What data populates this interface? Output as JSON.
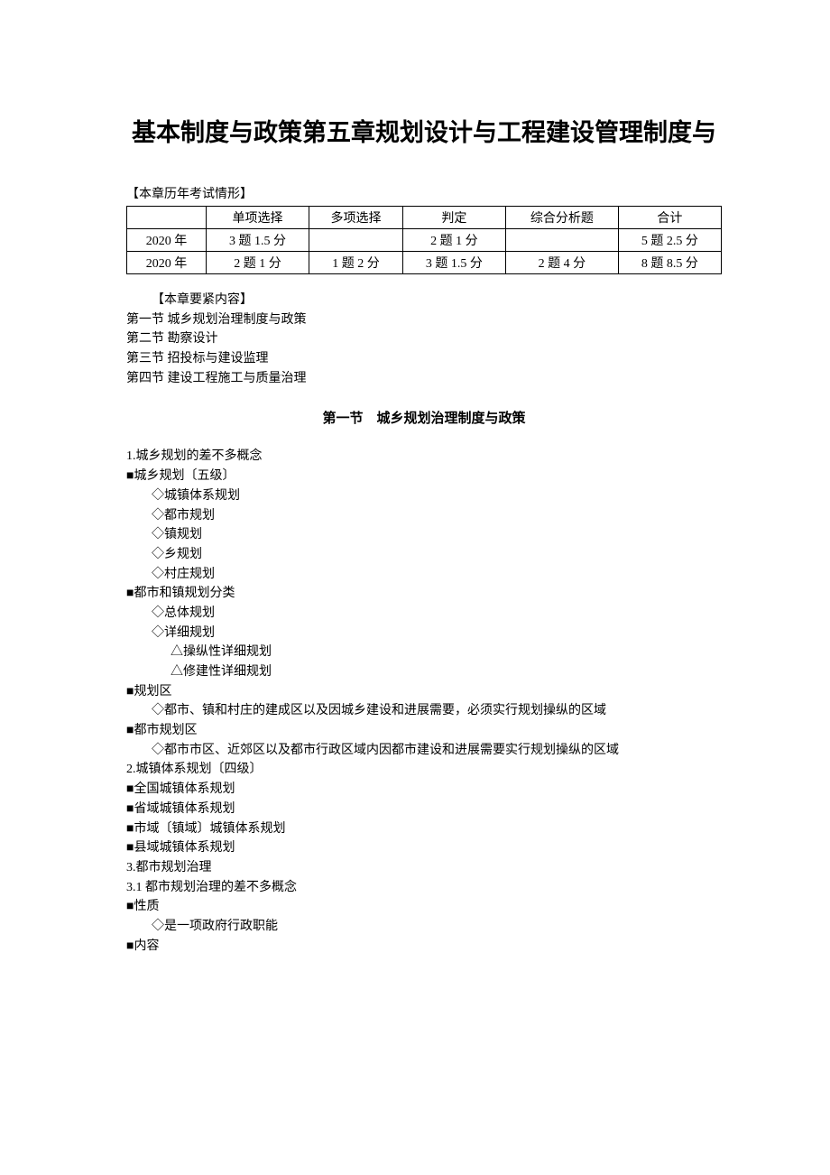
{
  "title": "基本制度与政策第五章规划设计与工程建设管理制度与",
  "exam_intro": "【本章历年考试情形】",
  "table": {
    "headers": [
      "",
      "单项选择",
      "多项选择",
      "判定",
      "综合分析题",
      "合计"
    ],
    "rows": [
      [
        "2020 年",
        "3 题 1.5 分",
        "",
        "2 题 1 分",
        "",
        "5 题 2.5 分"
      ],
      [
        "2020 年",
        "2 题 1 分",
        "1 题 2 分",
        "3 题 1.5 分",
        "2 题 4 分",
        "8 题 8.5 分"
      ]
    ]
  },
  "contents_intro": "【本章要紧内容】",
  "contents": [
    "第一节  城乡规划治理制度与政策",
    "第二节  勘察设计",
    "第三节  招投标与建设监理",
    "第四节  建设工程施工与质量治理"
  ],
  "section1_title": "第一节　城乡规划治理制度与政策",
  "s1_p1": "1.城乡规划的差不多概念",
  "s1_b1": "城乡规划〔五级〕",
  "s1_d1": "城镇体系规划",
  "s1_d2": "都市规划",
  "s1_d3": "镇规划",
  "s1_d4": "乡规划",
  "s1_d5": "村庄规划",
  "s1_b2": "都市和镇规划分类",
  "s1_d6": "总体规划",
  "s1_d7": "详细规划",
  "s1_t1": "操纵性详细规划",
  "s1_t2": "修建性详细规划",
  "s1_b3": "规划区",
  "s1_d8": "都市、镇和村庄的建成区以及因城乡建设和进展需要，必须实行规划操纵的区域",
  "s1_b4": "都市规划区",
  "s1_d9": "都市市区、近郊区以及都市行政区域内因都市建设和进展需要实行规划操纵的区域",
  "s1_p2": "2.城镇体系规划〔四级〕",
  "s1_b5": "全国城镇体系规划",
  "s1_b6": "省域城镇体系规划",
  "s1_b7": "市域〔镇域〕城镇体系规划",
  "s1_b8": "县域城镇体系规划",
  "s1_p3": "3.都市规划治理",
  "s1_p4": "3.1  都市规划治理的差不多概念",
  "s1_b9": "性质",
  "s1_d10": "是一项政府行政职能",
  "s1_b10": "内容"
}
